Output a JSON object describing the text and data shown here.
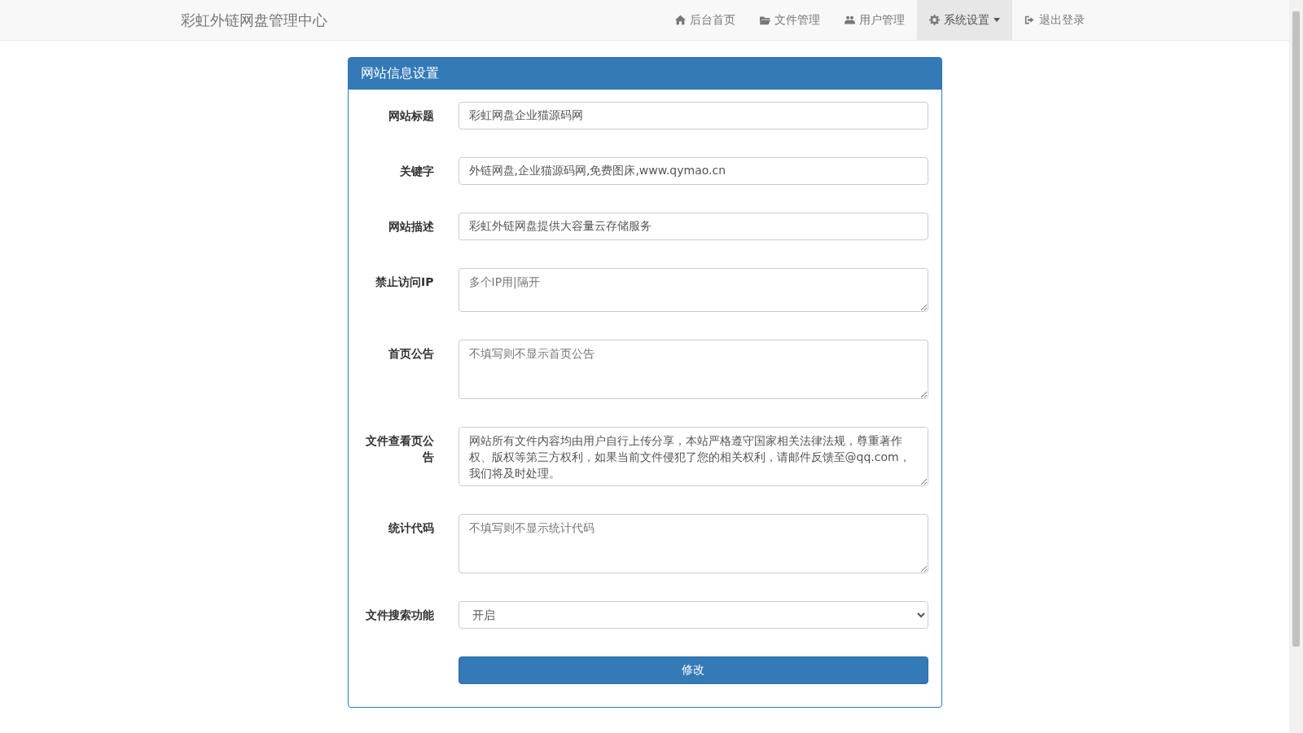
{
  "navbar": {
    "brand": "彩虹外链网盘管理中心",
    "items": [
      {
        "label": "后台首页",
        "selected": false,
        "dropdown": false
      },
      {
        "label": "文件管理",
        "selected": false,
        "dropdown": false
      },
      {
        "label": "用户管理",
        "selected": false,
        "dropdown": false
      },
      {
        "label": "系统设置",
        "selected": true,
        "dropdown": true
      },
      {
        "label": "退出登录",
        "selected": false,
        "dropdown": false
      }
    ]
  },
  "panel": {
    "title": "网站信息设置",
    "fields": [
      {
        "kind": "input",
        "label": "网站标题",
        "value": "彩虹网盘企业猫源码网"
      },
      {
        "kind": "input",
        "label": "关键字",
        "value": "外链网盘,企业猫源码网,免费图床,www.qymao.cn"
      },
      {
        "kind": "input",
        "label": "网站描述",
        "value": "彩虹外链网盘提供大容量云存储服务"
      },
      {
        "kind": "textarea",
        "label": "禁止访问IP",
        "placeholder": "多个IP用|隔开"
      },
      {
        "kind": "textarea",
        "label": "首页公告",
        "placeholder": "不填写则不显示首页公告"
      },
      {
        "kind": "textarea",
        "label": "文件查看页公告",
        "value": "网站所有文件内容均由用户自行上传分享，本站严格遵守国家相关法律法规，尊重著作权、版权等第三方权利，如果当前文件侵犯了您的相关权利，请邮件反馈至@qq.com，我们将及时处理。"
      },
      {
        "kind": "textarea",
        "label": "统计代码",
        "placeholder": "不填写则不显示统计代码"
      },
      {
        "kind": "select",
        "label": "文件搜索功能",
        "value": "开启"
      }
    ],
    "submit": "修改"
  }
}
